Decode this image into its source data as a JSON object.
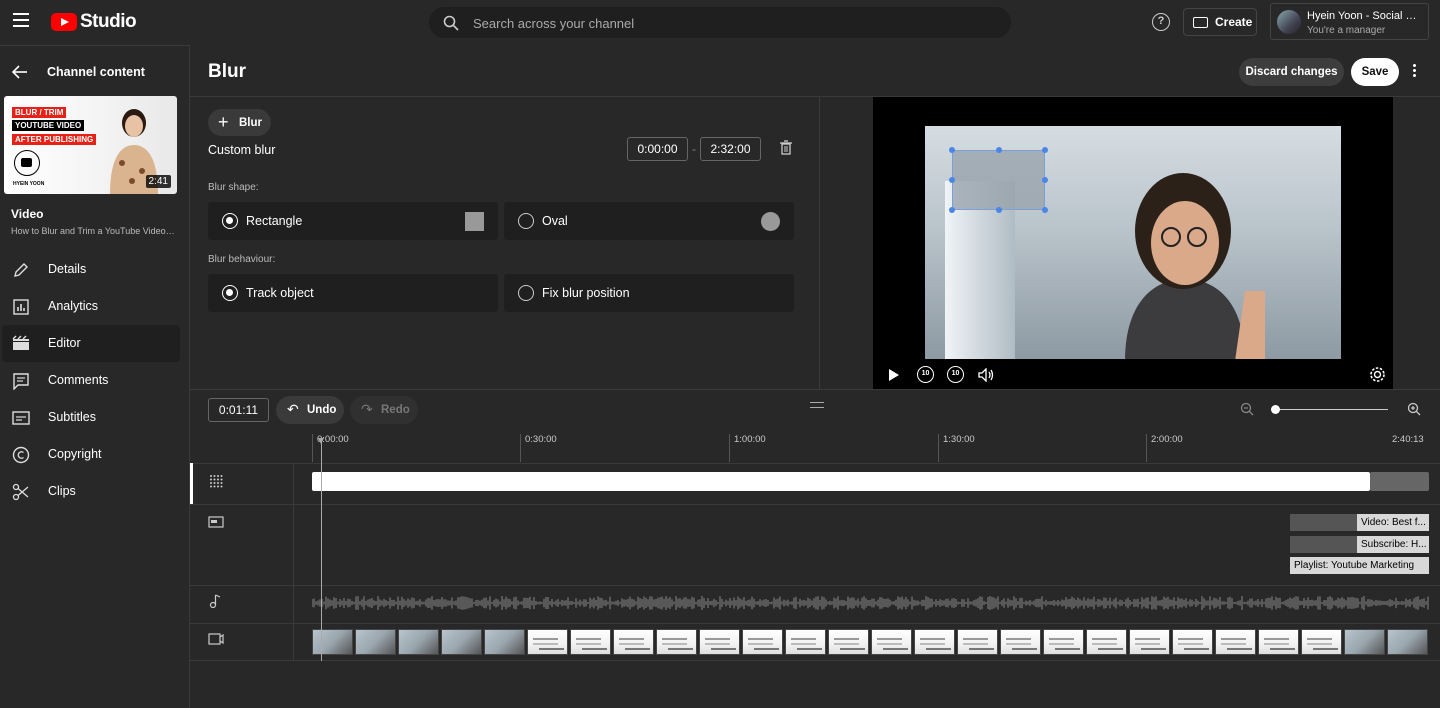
{
  "app": {
    "logo_text": "Studio",
    "brand_color": "#ff0000"
  },
  "search": {
    "placeholder": "Search across your channel"
  },
  "header": {
    "create_label": "Create",
    "account_name": "Hyein Yoon - Social Media Hub",
    "account_role": "You're a manager"
  },
  "sidebar": {
    "back_label": "Channel content",
    "thumbnail": {
      "lines": [
        "BLUR / TRIM",
        "YOUTUBE VIDEO",
        "AFTER PUBLISHING"
      ],
      "author": "HYEIN YOON",
      "duration": "2:41"
    },
    "video_label": "Video",
    "video_title": "How to Blur and Trim a YouTube Video After Publishing",
    "items": [
      {
        "label": "Details",
        "icon": "pencil-icon",
        "active": false
      },
      {
        "label": "Analytics",
        "icon": "bar-chart-icon",
        "active": false
      },
      {
        "label": "Editor",
        "icon": "clapperboard-icon",
        "active": true
      },
      {
        "label": "Comments",
        "icon": "comment-icon",
        "active": false
      },
      {
        "label": "Subtitles",
        "icon": "subtitles-icon",
        "active": false
      },
      {
        "label": "Copyright",
        "icon": "copyright-icon",
        "active": false
      },
      {
        "label": "Clips",
        "icon": "scissors-icon",
        "active": false
      }
    ]
  },
  "editor": {
    "title": "Blur",
    "discard_label": "Discard changes",
    "save_label": "Save",
    "add_blur_label": "Blur",
    "blur_name": "Custom blur",
    "start_time": "0:00:00",
    "separator": "-",
    "end_time": "2:32:00",
    "shape_label": "Blur shape:",
    "shape_options": [
      "Rectangle",
      "Oval"
    ],
    "shape_selected": "Rectangle",
    "behaviour_label": "Blur behaviour:",
    "behaviour_options": [
      "Track object",
      "Fix blur position"
    ],
    "behaviour_selected": "Track object"
  },
  "player": {
    "skip_back": "10",
    "skip_forward": "10"
  },
  "timeline": {
    "current_time": "0:01:11",
    "undo_label": "Undo",
    "redo_label": "Redo",
    "ticks": [
      "0:00:00",
      "0:30:00",
      "1:00:00",
      "1:30:00",
      "2:00:00",
      "2:40:13"
    ],
    "end_cards": [
      "Video: Best f...",
      "Subscribe: H...",
      "Playlist: Youtube Marketing"
    ],
    "zoom_level": 0
  }
}
